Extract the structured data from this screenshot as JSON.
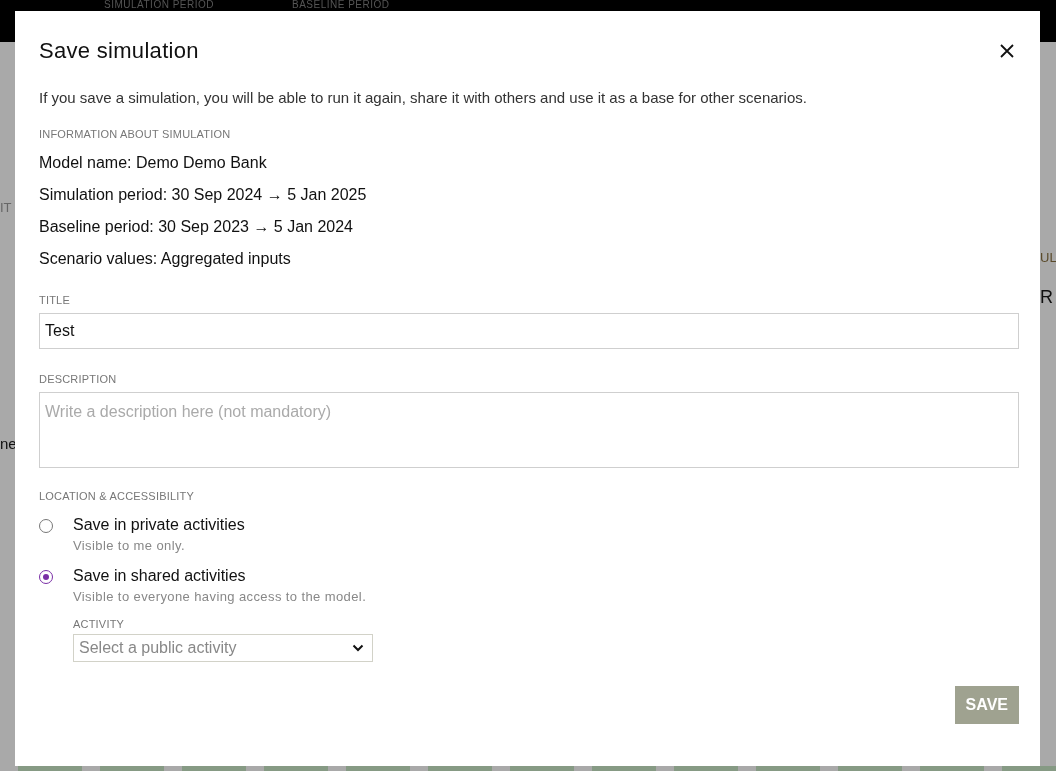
{
  "background": {
    "header_labels": [
      "SIMULATION PERIOD",
      "BASELINE PERIOD"
    ],
    "left_fragments": [
      "IT",
      "ne"
    ],
    "right_fragments": [
      "UL",
      "R"
    ]
  },
  "dialog": {
    "title": "Save simulation",
    "intro": "If you save a simulation, you will be able to run it again, share it with others and use it as a base for other scenarios.",
    "info_heading": "INFORMATION ABOUT SIMULATION",
    "info_lines": [
      "Model name: Demo Demo Bank",
      "Simulation period: 30 Sep 2024 → 5 Jan 2025",
      "Baseline period: 30 Sep 2023 → 5 Jan 2024",
      "Scenario values: Aggregated inputs"
    ],
    "title_field": {
      "label": "TITLE",
      "value": "Test"
    },
    "description_field": {
      "label": "DESCRIPTION",
      "placeholder": "Write a description here (not mandatory)"
    },
    "location_heading": "LOCATION & ACCESSIBILITY",
    "options": [
      {
        "label": "Save in private activities",
        "hint": "Visible to me only.",
        "selected": false
      },
      {
        "label": "Save in shared activities",
        "hint": "Visible to everyone having access to the model.",
        "selected": true,
        "activity": {
          "label": "ACTIVITY",
          "placeholder": "Select a public activity"
        }
      }
    ],
    "save_button": {
      "label": "SAVE",
      "disabled": true
    }
  }
}
